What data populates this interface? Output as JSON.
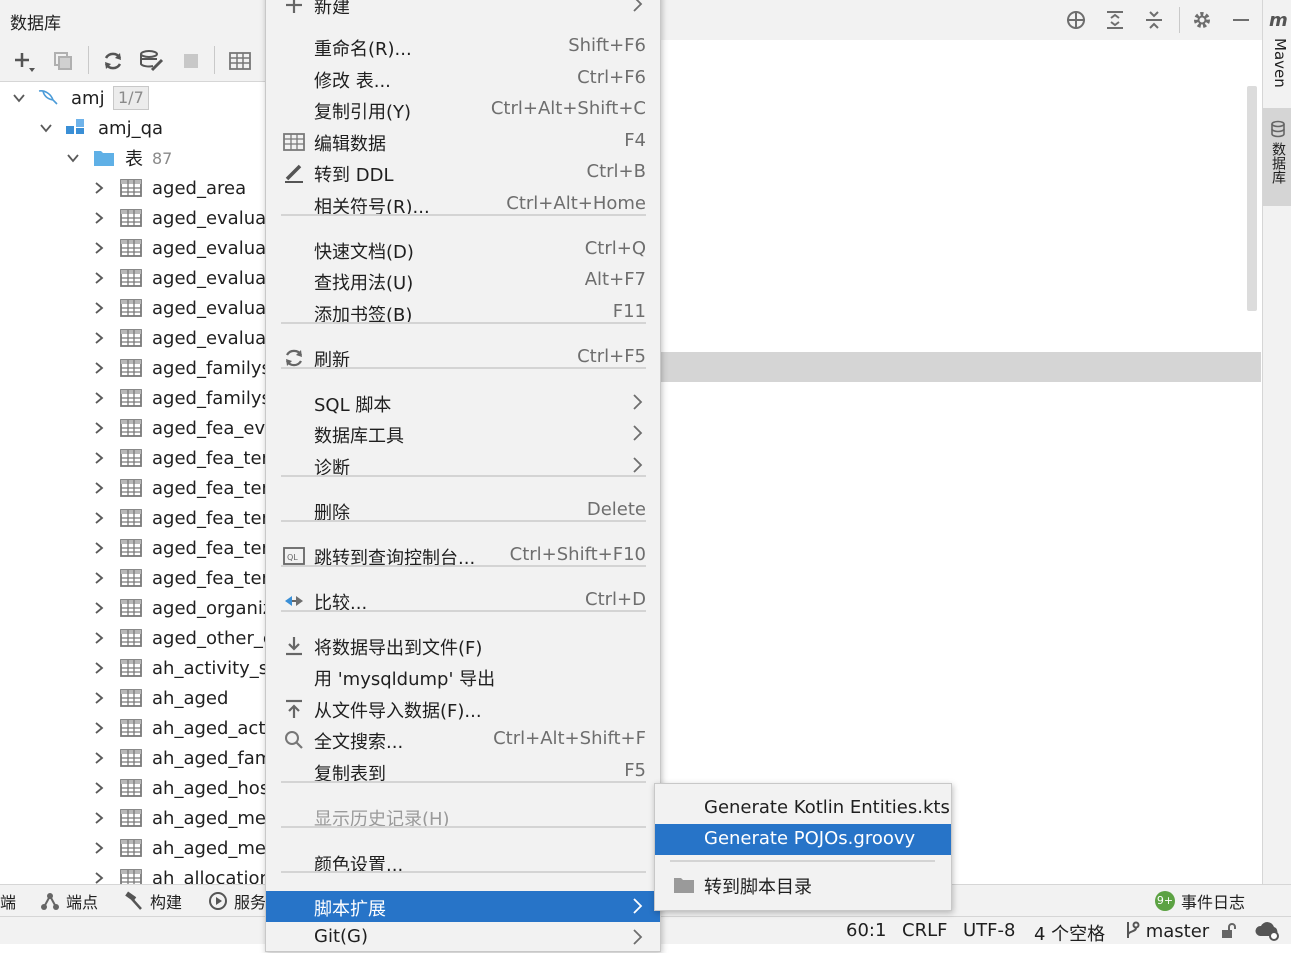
{
  "panel": {
    "title": "数据库"
  },
  "tree": {
    "connection": {
      "name": "amj",
      "badge": "1/7"
    },
    "schema": {
      "name": "amj_qa"
    },
    "folder": {
      "name": "表",
      "count": "87"
    },
    "tables": [
      "aged_area",
      "aged_evaluat",
      "aged_evaluat",
      "aged_evaluat",
      "aged_evaluat",
      "aged_evaluat",
      "aged_familys",
      "aged_familys",
      "aged_fea_eva",
      "aged_fea_ten",
      "aged_fea_ten",
      "aged_fea_ten",
      "aged_fea_ten",
      "aged_fea_ten",
      "aged_organiz",
      "aged_other_c",
      "ah_activity_si",
      "ah_aged",
      "ah_aged_acti",
      "ah_aged_fam",
      "ah_aged_hos",
      "ah_aged_mec",
      "ah_aged_mer",
      "ah_allocation"
    ],
    "selected_index": 6
  },
  "rightbar": {
    "maven_label": "Maven",
    "database_label": "数据库"
  },
  "context_menu": {
    "items": [
      {
        "label": "新建",
        "shortcut": "",
        "icon": "plus-icon",
        "submenu": true
      },
      {
        "label": "重命名(R)...",
        "shortcut": "Shift+F6",
        "icon": "",
        "submenu": false
      },
      {
        "label": "修改 表...",
        "shortcut": "Ctrl+F6",
        "icon": "",
        "submenu": false
      },
      {
        "label": "复制引用(Y)",
        "shortcut": "Ctrl+Alt+Shift+C",
        "icon": "",
        "submenu": false
      },
      {
        "label": "编辑数据",
        "shortcut": "F4",
        "icon": "table-icon",
        "submenu": false
      },
      {
        "label": "转到 DDL",
        "shortcut": "Ctrl+B",
        "icon": "pencil-icon",
        "submenu": false
      },
      {
        "label": "相关符号(R)...",
        "shortcut": "Ctrl+Alt+Home",
        "icon": "",
        "submenu": false
      },
      {
        "label": "快速文档(D)",
        "shortcut": "Ctrl+Q",
        "icon": "",
        "submenu": false
      },
      {
        "label": "查找用法(U)",
        "shortcut": "Alt+F7",
        "icon": "",
        "submenu": false
      },
      {
        "label": "添加书签(B)",
        "shortcut": "F11",
        "icon": "",
        "submenu": false
      },
      {
        "label": "刷新",
        "shortcut": "Ctrl+F5",
        "icon": "refresh-icon",
        "submenu": false
      },
      {
        "label": "SQL 脚本",
        "shortcut": "",
        "icon": "",
        "submenu": true
      },
      {
        "label": "数据库工具",
        "shortcut": "",
        "icon": "",
        "submenu": true
      },
      {
        "label": "诊断",
        "shortcut": "",
        "icon": "",
        "submenu": true
      },
      {
        "label": "删除",
        "shortcut": "Delete",
        "icon": "",
        "submenu": false
      },
      {
        "label": "跳转到查询控制台...",
        "shortcut": "Ctrl+Shift+F10",
        "icon": "console-icon",
        "submenu": false
      },
      {
        "label": "比较...",
        "shortcut": "Ctrl+D",
        "icon": "compare-icon",
        "submenu": false
      },
      {
        "label": "将数据导出到文件(F)",
        "shortcut": "",
        "icon": "export-icon",
        "submenu": false
      },
      {
        "label": "用 'mysqldump' 导出",
        "shortcut": "",
        "icon": "",
        "submenu": false
      },
      {
        "label": "从文件导入数据(F)...",
        "shortcut": "",
        "icon": "import-icon",
        "submenu": false
      },
      {
        "label": "全文搜索...",
        "shortcut": "Ctrl+Alt+Shift+F",
        "icon": "search-icon",
        "submenu": false
      },
      {
        "label": "复制表到",
        "shortcut": "F5",
        "icon": "",
        "submenu": false
      },
      {
        "label": "显示历史记录(H)",
        "shortcut": "",
        "icon": "",
        "submenu": false,
        "disabled": true
      },
      {
        "label": "颜色设置...",
        "shortcut": "",
        "icon": "",
        "submenu": false
      },
      {
        "label": "脚本扩展",
        "shortcut": "",
        "icon": "",
        "submenu": true,
        "active": true
      },
      {
        "label": "Git(G)",
        "shortcut": "",
        "icon": "",
        "submenu": true
      }
    ]
  },
  "submenu": {
    "items": [
      {
        "label": "Generate Kotlin Entities.kts"
      },
      {
        "label": "Generate POJOs.groovy",
        "active": true
      },
      {
        "label": "转到脚本目录",
        "icon": "folder-icon"
      }
    ]
  },
  "bottom_tabs": {
    "terminal_fragment": "端",
    "endpoints": "端点",
    "build": "构建",
    "services": "服务",
    "event_log": "事件日志",
    "event_badge": "9+"
  },
  "status": {
    "position": "60:1",
    "line_sep": "CRLF",
    "encoding": "UTF-8",
    "indent": "4 个空格",
    "branch": "master"
  },
  "colors": {
    "accent": "#2774c8",
    "selection": "#d5d5d5",
    "mysql_blue": "#4a9bd8",
    "folder_blue": "#5fb0e6",
    "event_green": "#5ca243"
  }
}
